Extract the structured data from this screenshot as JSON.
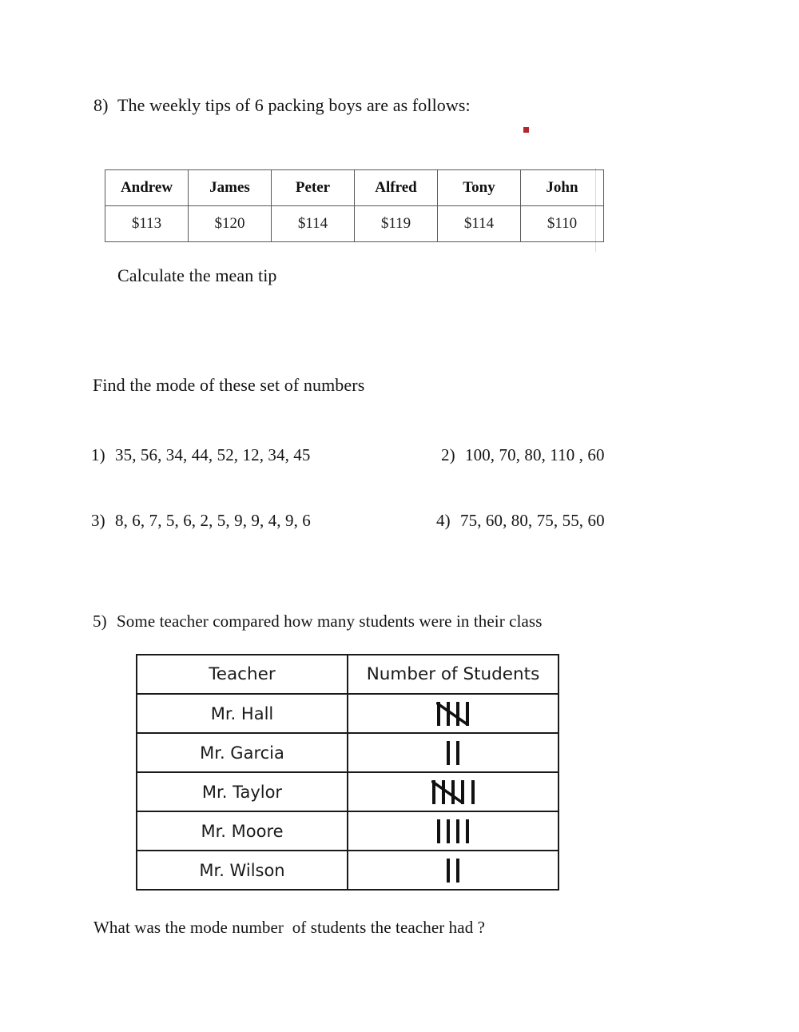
{
  "document": {
    "type": "math-worksheet",
    "topic": "Mean and Mode"
  },
  "question_8": {
    "number": "8)",
    "prompt": "The weekly tips of 6 packing boys are as follows:",
    "table": {
      "names": [
        "Andrew",
        "James",
        "Peter",
        "Alfred",
        "Tony",
        "John"
      ],
      "amounts": [
        "$113",
        "$120",
        "$114",
        "$119",
        "$114",
        "$110"
      ]
    },
    "follow_up": "Calculate the mean tip"
  },
  "mode_section": {
    "heading": "Find the mode of these set of numbers",
    "questions": [
      {
        "number": "1)",
        "numbers": "35, 56, 34, 44, 52, 12, 34, 45"
      },
      {
        "number": "2)",
        "numbers": "100, 70, 80, 110 , 60"
      },
      {
        "number": "3)",
        "numbers": "8, 6, 7, 5, 6, 2, 5, 9, 9, 4, 9, 6"
      },
      {
        "number": "4)",
        "numbers": "75, 60, 80, 75, 55, 60"
      }
    ]
  },
  "question_5": {
    "number": "5)",
    "prompt": "Some teacher compared how many students were in their class",
    "table": {
      "headers": [
        "Teacher",
        "Number of Students"
      ],
      "rows": [
        {
          "teacher": "Mr. Hall",
          "tally_count": 5
        },
        {
          "teacher": "Mr. Garcia",
          "tally_count": 2
        },
        {
          "teacher": "Mr. Taylor",
          "tally_count": 6
        },
        {
          "teacher": "Mr. Moore",
          "tally_count": 4
        },
        {
          "teacher": "Mr. Wilson",
          "tally_count": 2
        }
      ]
    },
    "follow_up": "What was the mode number  of students the teacher had ?"
  },
  "colors": {
    "text": "#141414",
    "table_border": "#1a1a1a",
    "tips_border": "#5a5a5a",
    "speck": "#b4262c"
  }
}
